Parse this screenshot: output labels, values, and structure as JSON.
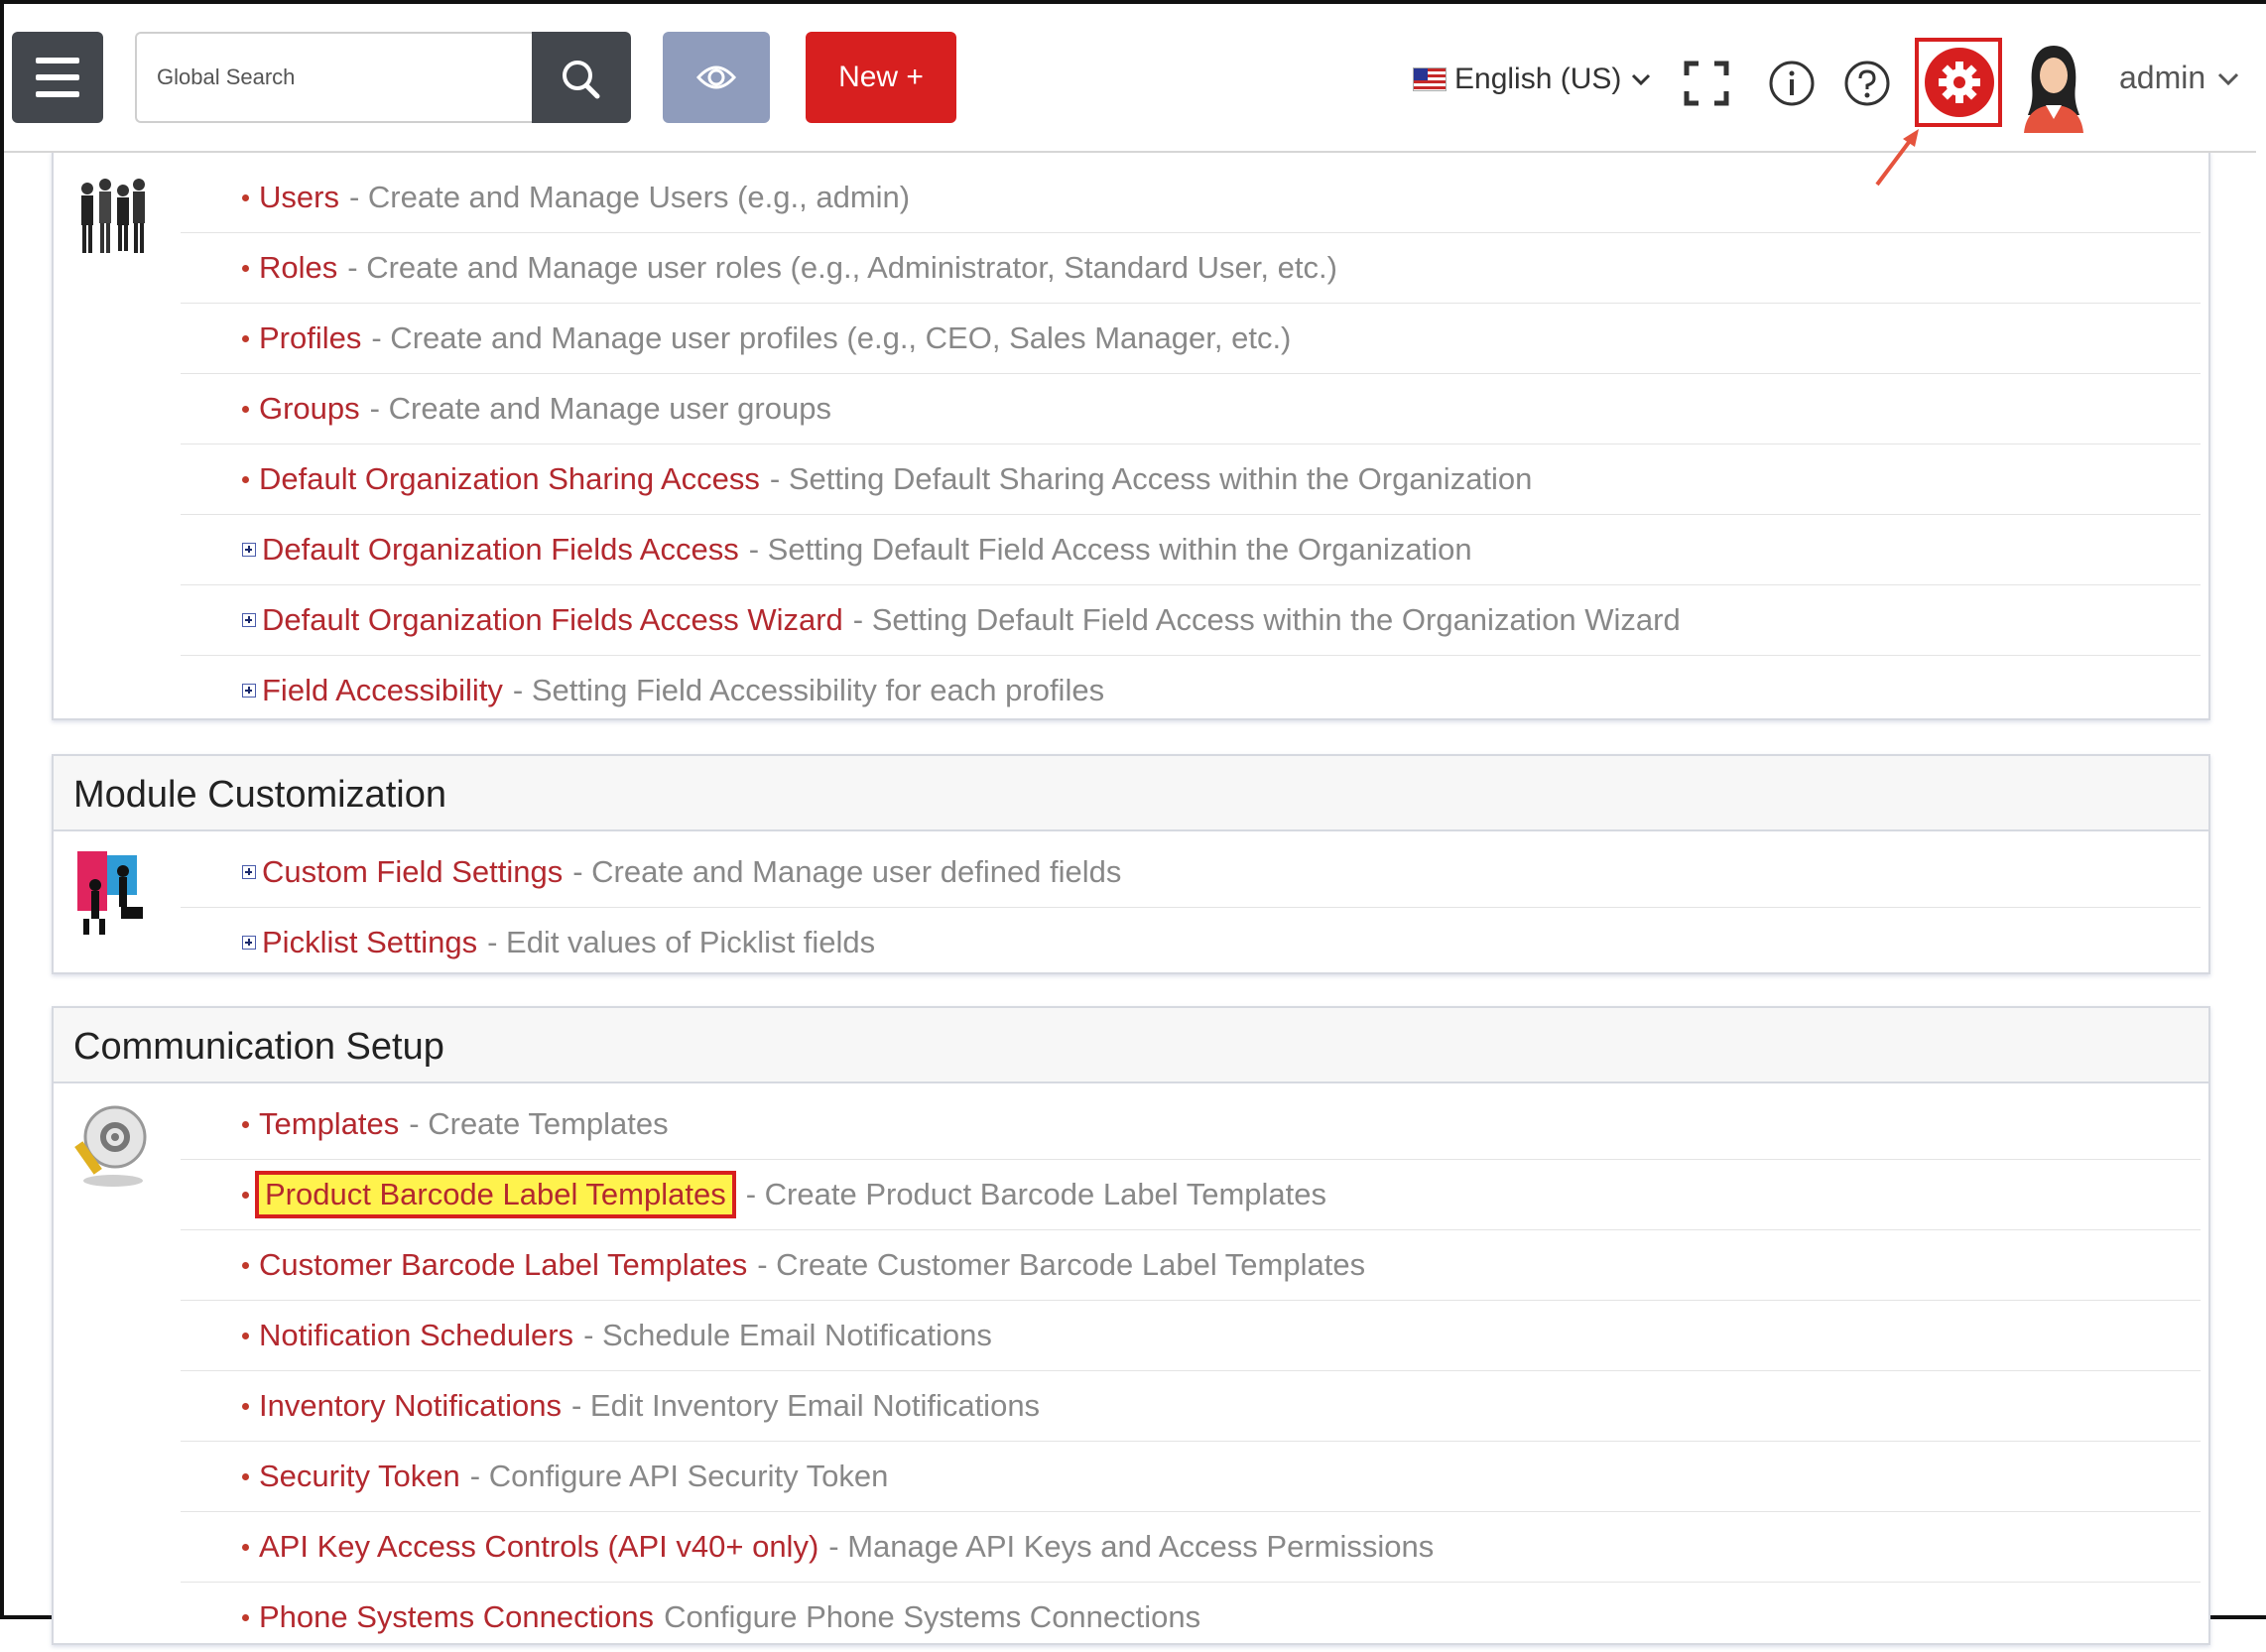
{
  "topbar": {
    "search_placeholder": "Global Search",
    "new_button_label": "New +",
    "language_label": "English (US)",
    "user_name": "admin"
  },
  "user_management": {
    "items": [
      {
        "name": "Users",
        "desc": "- Create and Manage Users (e.g., admin)",
        "marker": "bullet"
      },
      {
        "name": "Roles",
        "desc": "- Create and Manage user roles (e.g., Administrator, Standard User, etc.)",
        "marker": "bullet"
      },
      {
        "name": "Profiles",
        "desc": "- Create and Manage user profiles (e.g., CEO, Sales Manager, etc.)",
        "marker": "bullet"
      },
      {
        "name": "Groups",
        "desc": "- Create and Manage user groups",
        "marker": "bullet"
      },
      {
        "name": "Default Organization Sharing Access",
        "desc": "- Setting Default Sharing Access within the Organization",
        "marker": "bullet"
      },
      {
        "name": "Default Organization Fields Access",
        "desc": "- Setting Default Field Access within the Organization",
        "marker": "plus"
      },
      {
        "name": "Default Organization Fields Access Wizard",
        "desc": "- Setting Default Field Access within the Organization Wizard",
        "marker": "plus"
      },
      {
        "name": "Field Accessibility",
        "desc": "- Setting Field Accessibility for each profiles",
        "marker": "plus"
      }
    ]
  },
  "module_customization": {
    "title": "Module Customization",
    "items": [
      {
        "name": "Custom Field Settings",
        "desc": "- Create and Manage user defined fields",
        "marker": "plus"
      },
      {
        "name": "Picklist Settings",
        "desc": "- Edit values of Picklist fields",
        "marker": "plus"
      }
    ]
  },
  "communication_setup": {
    "title": "Communication Setup",
    "items": [
      {
        "name": "Templates",
        "desc": "- Create Templates",
        "marker": "bullet"
      },
      {
        "name": "Product Barcode Label Templates",
        "desc": "- Create Product Barcode Label Templates",
        "marker": "bullet"
      },
      {
        "name": "Customer Barcode Label Templates",
        "desc": "- Create Customer Barcode Label Templates",
        "marker": "bullet"
      },
      {
        "name": "Notification Schedulers",
        "desc": "- Schedule Email Notifications",
        "marker": "bullet"
      },
      {
        "name": "Inventory Notifications",
        "desc": "- Edit Inventory Email Notifications",
        "marker": "bullet"
      },
      {
        "name": "Security Token",
        "desc": "- Configure API Security Token",
        "marker": "bullet"
      },
      {
        "name": "API Key Access Controls (API v40+ only)",
        "desc": "- Manage API Keys and Access Permissions",
        "marker": "bullet"
      },
      {
        "name": "Phone Systems Connections",
        "desc": "Configure Phone Systems Connections",
        "marker": "bullet"
      }
    ]
  },
  "colors": {
    "accent": "#d71f1f",
    "link": "#b3282e",
    "highlight": "#fff34d"
  }
}
